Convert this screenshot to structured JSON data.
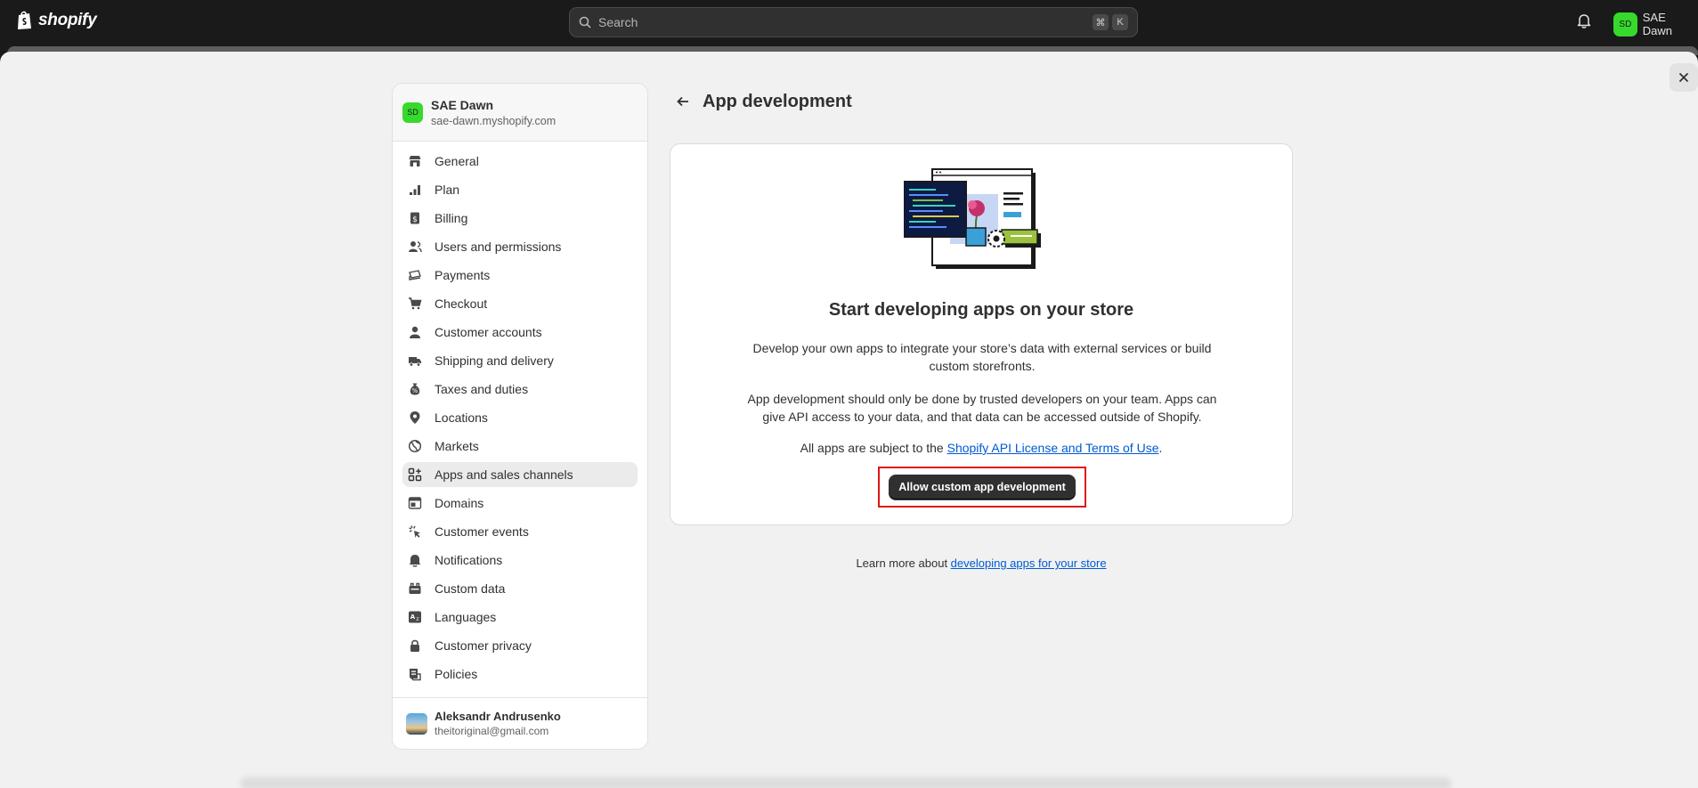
{
  "topbar": {
    "logo_text": "shopify",
    "search_placeholder": "Search",
    "shortcut_keys": [
      "⌘",
      "K"
    ],
    "user_initials": "SD",
    "user_name": "SAE Dawn"
  },
  "sidebar": {
    "store": {
      "initials": "SD",
      "name": "SAE Dawn",
      "url": "sae-dawn.myshopify.com"
    },
    "items": [
      {
        "label": "General",
        "icon": "store-icon"
      },
      {
        "label": "Plan",
        "icon": "plan-icon"
      },
      {
        "label": "Billing",
        "icon": "billing-icon"
      },
      {
        "label": "Users and permissions",
        "icon": "users-icon"
      },
      {
        "label": "Payments",
        "icon": "payments-icon"
      },
      {
        "label": "Checkout",
        "icon": "cart-icon"
      },
      {
        "label": "Customer accounts",
        "icon": "person-icon"
      },
      {
        "label": "Shipping and delivery",
        "icon": "truck-icon"
      },
      {
        "label": "Taxes and duties",
        "icon": "tax-icon"
      },
      {
        "label": "Locations",
        "icon": "location-icon"
      },
      {
        "label": "Markets",
        "icon": "globe-icon"
      },
      {
        "label": "Apps and sales channels",
        "icon": "apps-icon",
        "active": true
      },
      {
        "label": "Domains",
        "icon": "domains-icon"
      },
      {
        "label": "Customer events",
        "icon": "cursor-icon"
      },
      {
        "label": "Notifications",
        "icon": "bell-icon"
      },
      {
        "label": "Custom data",
        "icon": "database-icon"
      },
      {
        "label": "Languages",
        "icon": "language-icon"
      },
      {
        "label": "Customer privacy",
        "icon": "lock-icon"
      },
      {
        "label": "Policies",
        "icon": "policies-icon"
      }
    ],
    "user": {
      "name": "Aleksandr Andrusenko",
      "email": "theitoriginal@gmail.com"
    }
  },
  "page": {
    "title": "App development"
  },
  "card": {
    "title": "Start developing apps on your store",
    "para1": "Develop your own apps to integrate your store’s data with external services or build custom storefronts.",
    "para2": "App development should only be done by trusted developers on your team. Apps can give API access to your data, and that data can be accessed outside of Shopify.",
    "terms_prefix": "All apps are subject to the ",
    "terms_link": "Shopify API License and Terms of Use",
    "terms_suffix": ".",
    "button_label": "Allow custom app development"
  },
  "learn_more": {
    "prefix": "Learn more about ",
    "link": "developing apps for your store"
  },
  "colors": {
    "accent_green": "#36d92c",
    "link_blue": "#005bd3",
    "highlight_red": "#e01515"
  }
}
